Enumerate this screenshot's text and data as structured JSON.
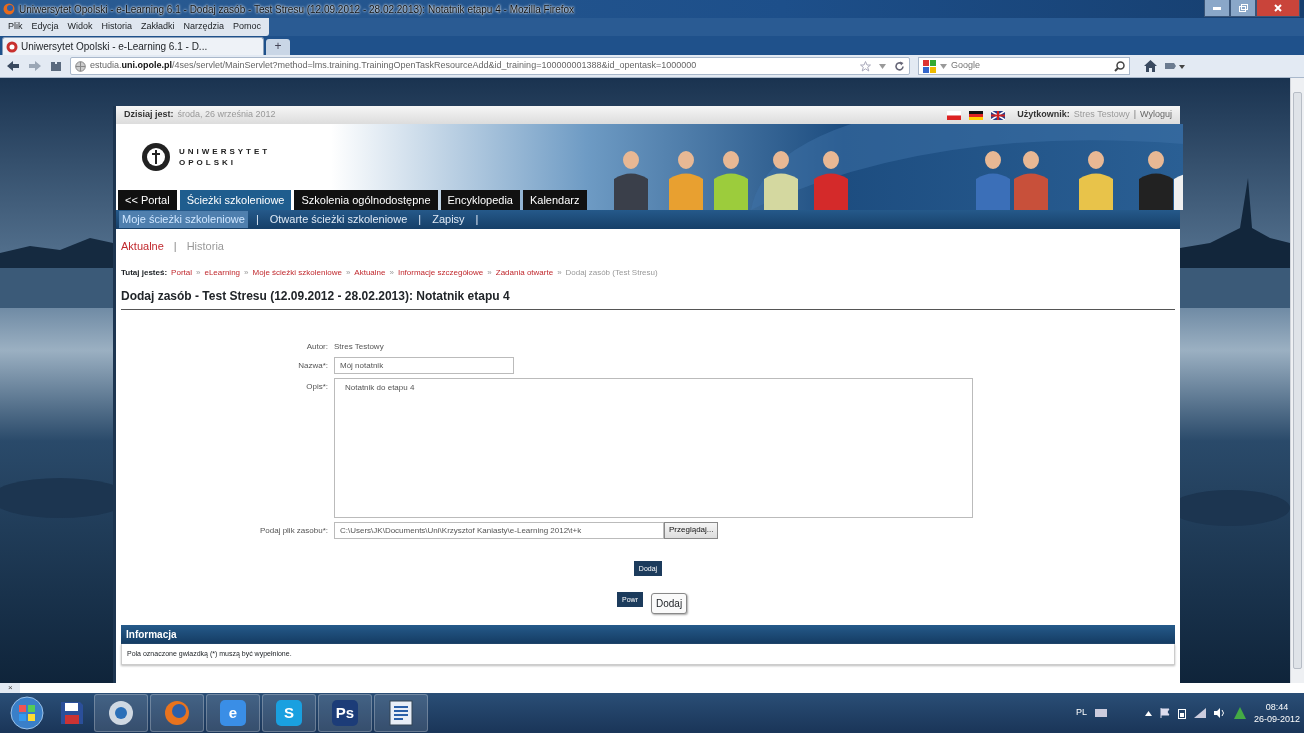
{
  "window": {
    "title": "Uniwersytet Opolski - e-Learning 6.1 - Dodaj zasób - Test Stresu (12.09.2012 - 28.02.2013): Notatnik etapu 4 - Mozilla Firefox"
  },
  "menu_bar": [
    "Plik",
    "Edycja",
    "Widok",
    "Historia",
    "Zakładki",
    "Narzędzia",
    "Pomoc"
  ],
  "browser_tabs": [
    {
      "label": "Uniwersytet Opolski - e-Learning 6.1 - D...",
      "selected": true
    }
  ],
  "new_tab": "+",
  "address_bar": {
    "url": "estudia.**uni.opole.pl**/4ses/servlet/MainServlet?method=lms.training.TrainingOpenTaskResourceAdd&id_training=100000001388&id_opentask=1000000"
  },
  "search_bar": {
    "placeholder": "Google"
  },
  "page": {
    "date_label": "Dzisiaj jest:",
    "date": "środa, 26 września 2012",
    "user_label": "Użytkownik:",
    "user": "Stres Testowy",
    "user_separator": "|",
    "logout": "Wyloguj",
    "logo_lines": [
      "UNIWERSYTET",
      "OPOLSKI"
    ],
    "main_nav": [
      {
        "label": "<< Portal",
        "selected": false
      },
      {
        "label": "Ścieżki szkoleniowe",
        "selected": true
      },
      {
        "label": "Szkolenia ogólnodostępne",
        "selected": false
      },
      {
        "label": "Encyklopedia",
        "selected": false
      },
      {
        "label": "Kalendarz",
        "selected": false
      }
    ],
    "sub_nav": {
      "separator": "|",
      "items": [
        {
          "label": "Moje ścieżki szkoleniowe",
          "selected": true
        },
        {
          "label": "Otwarte ścieżki szkoleniowe",
          "selected": false
        },
        {
          "label": "Zapisy",
          "selected": false
        }
      ]
    },
    "view_tabs": {
      "separator": "|",
      "items": [
        {
          "label": "Aktualne",
          "selected": true
        },
        {
          "label": "Historia",
          "selected": false
        }
      ]
    },
    "breadcrumb": {
      "label": "Tutaj jesteś:",
      "separator": "»",
      "items": [
        {
          "text": "Portal",
          "current": false
        },
        {
          "text": "eLearning",
          "current": false
        },
        {
          "text": "Moje ścieżki szkoleniowe",
          "current": false
        },
        {
          "text": "Aktualne",
          "current": false
        },
        {
          "text": "Informacje szczegółowe",
          "current": false
        },
        {
          "text": "Zadania otwarte",
          "current": false
        },
        {
          "text": "Dodaj zasób (Test Stresu)",
          "current": true
        }
      ]
    },
    "heading": "Dodaj zasób - Test Stresu (12.09.2012 - 28.02.2013): Notatnik etapu 4",
    "form": [
      {
        "kind": "text",
        "label": "Autor:",
        "value": "Stres Testowy"
      },
      {
        "kind": "input",
        "label": "Nazwa*:",
        "value": "Mój notatnik"
      },
      {
        "kind": "textarea",
        "label": "Opis*:",
        "value": "Notatnik do etapu 4"
      },
      {
        "kind": "file",
        "label": "Podaj plik zasobu*:",
        "value": "C:\\Users\\JK\\Documents\\Uni\\Krzysztof Kaniasty\\e-Learning 2012\\t+k",
        "button": "Przeglądaj..."
      }
    ],
    "submit": "Dodaj",
    "back": "Powr",
    "tooltip": "Dodaj",
    "info": {
      "title": "Informacja",
      "text": "Pola oznaczone gwiazdką (*) muszą być wypełnione."
    }
  },
  "status_bar": {
    "close": "×"
  },
  "taskbar": {
    "items": [
      {
        "kind": "start"
      },
      {
        "kind": "disk"
      },
      {
        "kind": "globe"
      },
      {
        "kind": "fox"
      },
      {
        "kind": "glyph",
        "glyph": "e",
        "color": "#3a8ee6"
      },
      {
        "kind": "glyph",
        "glyph": "S",
        "color": "#1aa0e0"
      },
      {
        "kind": "glyph",
        "glyph": "Ps",
        "color": "#1c3c78"
      },
      {
        "kind": "doc"
      }
    ],
    "language": "PL",
    "time": "08:44",
    "date": "26-09-2012"
  }
}
